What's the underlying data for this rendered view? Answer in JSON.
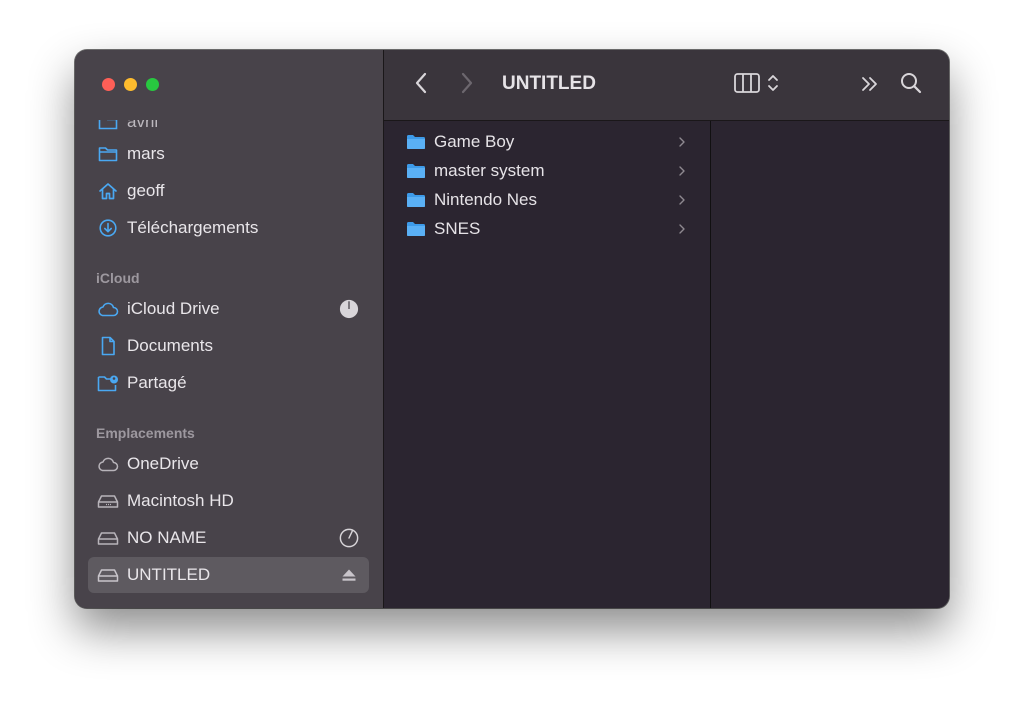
{
  "window": {
    "title": "UNTITLED"
  },
  "sidebar": {
    "partial_item": {
      "label": "avril"
    },
    "favorites": [
      {
        "label": "mars",
        "icon": "folder-icon"
      },
      {
        "label": "geoff",
        "icon": "home-icon"
      },
      {
        "label": "Téléchargements",
        "icon": "download-icon"
      }
    ],
    "icloud_heading": "iCloud",
    "icloud": [
      {
        "label": "iCloud Drive",
        "icon": "cloud-icon",
        "accessory": "sync-progress-icon"
      },
      {
        "label": "Documents",
        "icon": "document-icon"
      },
      {
        "label": "Partagé",
        "icon": "shared-folder-icon"
      }
    ],
    "locations_heading": "Emplacements",
    "locations": [
      {
        "label": "OneDrive",
        "icon": "cloud-icon"
      },
      {
        "label": "Macintosh HD",
        "icon": "disk-icon"
      },
      {
        "label": "NO NAME",
        "icon": "disk-icon",
        "accessory": "progress-icon"
      },
      {
        "label": "UNTITLED",
        "icon": "disk-icon",
        "accessory": "eject-icon",
        "selected": true
      }
    ]
  },
  "column1": {
    "items": [
      {
        "label": "Game Boy"
      },
      {
        "label": "master system"
      },
      {
        "label": "Nintendo Nes"
      },
      {
        "label": "SNES"
      }
    ]
  },
  "colors": {
    "accent": "#3d9bf0",
    "folder": "#3d9be9",
    "sidebar_icon": "#4aa8f2"
  }
}
